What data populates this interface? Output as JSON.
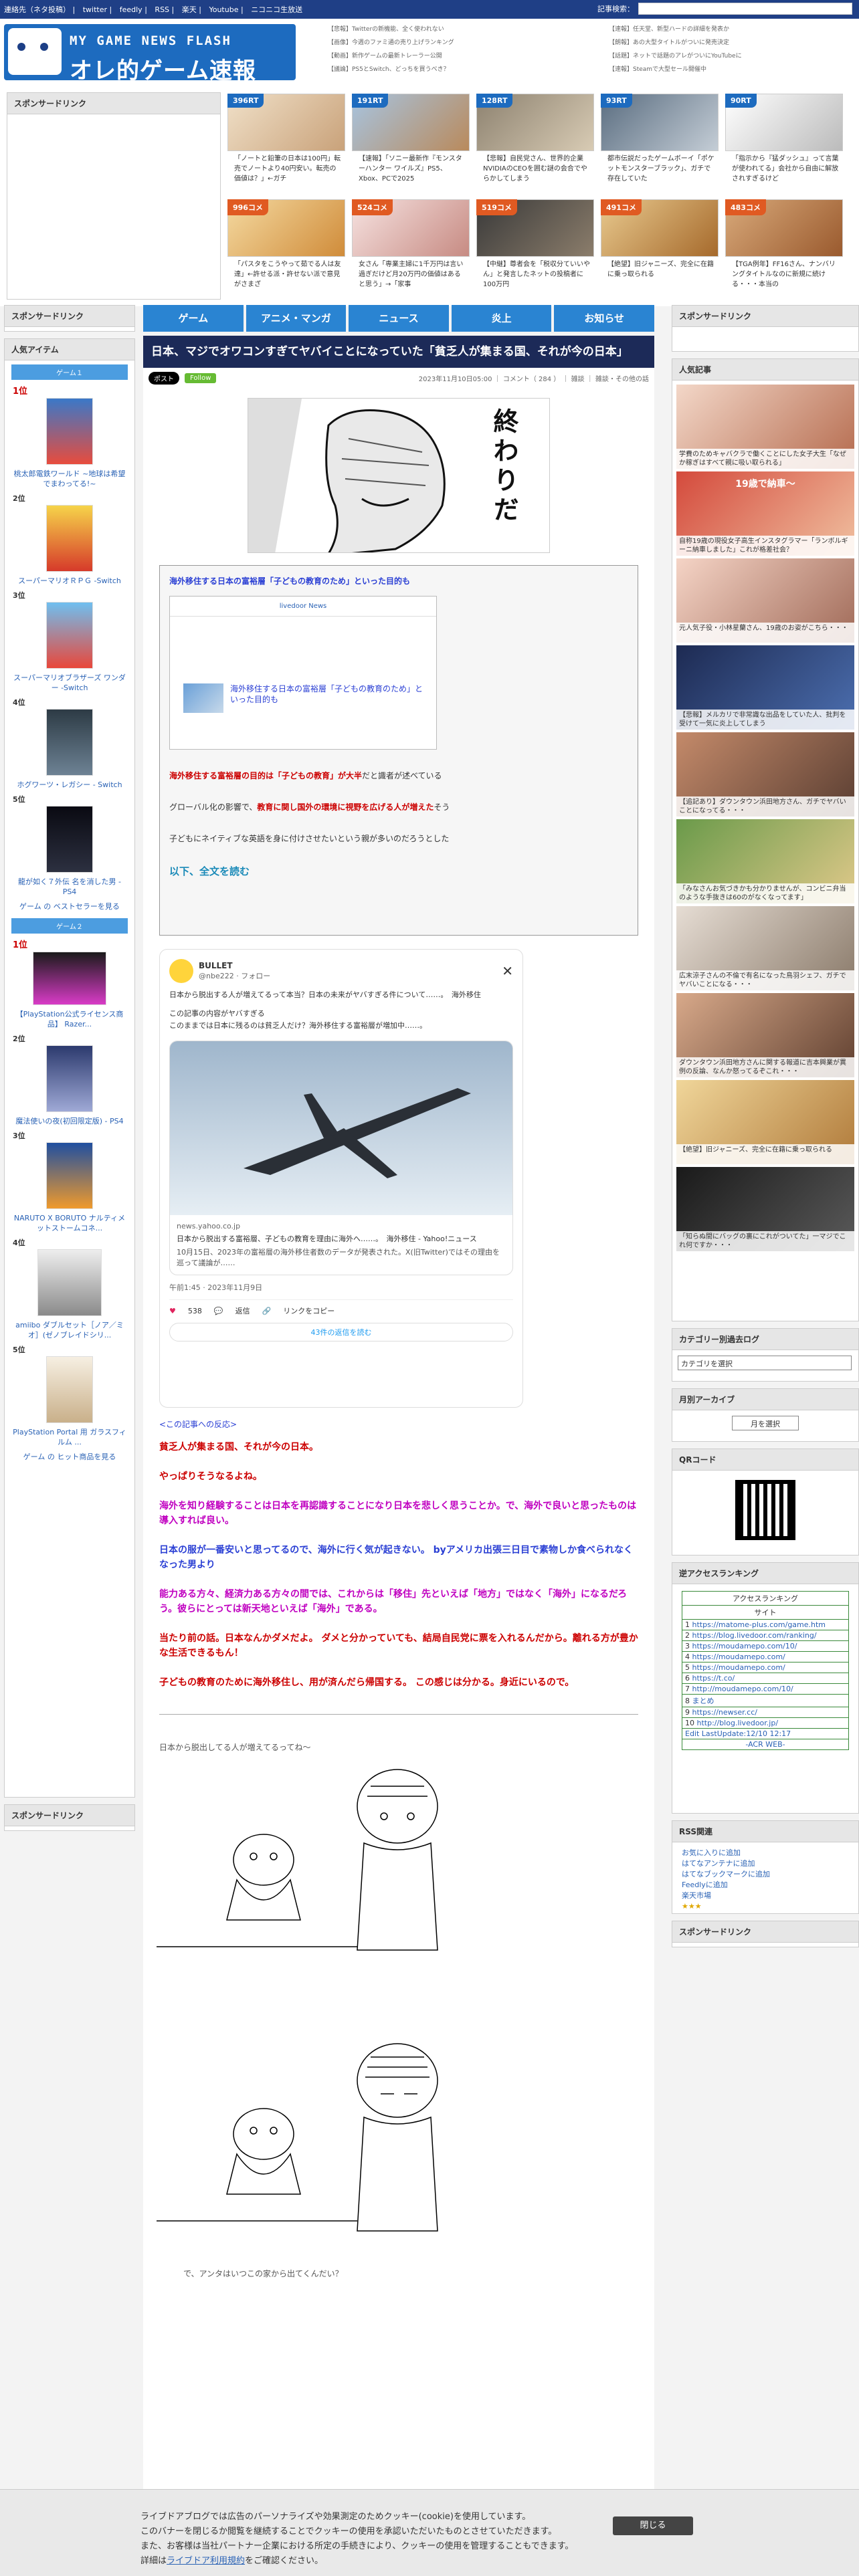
{
  "topbar": {
    "links": [
      "連絡先（ネタ投稿）",
      "twitter",
      "feedly",
      "RSS",
      "楽天",
      "Youtube",
      "ニコニコ生放送"
    ],
    "search_label": "記事検索："
  },
  "header": {
    "logo_line1": "MY GAME NEWS FLASH",
    "logo_line2": "オレ的ゲーム速報@JIN",
    "side_links": [
      "【悲報】Twitterの新機能、全く使われない",
      "【速報】任天堂、新型ハードの詳細を発表か",
      "【画像】今週のファミ通の売り上げランキング",
      "【朗報】あの大型タイトルがついに発売決定",
      "【動画】新作ゲームの最新トレーラー公開",
      "【話題】ネットで話題のアレがついにYouTubeに",
      "【議論】PS5とSwitch、どっちを買うべき？",
      "【速報】Steamで大型セール開催中"
    ]
  },
  "promo": {
    "sponsor_title": "スポンサードリンク",
    "tiles_row1": [
      {
        "badge": "396RT",
        "caption": "「ノートと鉛筆の日本は100円」転売でノートより40円安い。転売の価値は？」←ガチ"
      },
      {
        "badge": "191RT",
        "caption": "【速報】「ソニー最新作『モンスターハンター ワイルズ』PS5、Xbox、PCで2025"
      },
      {
        "badge": "128RT",
        "caption": "【悲報】自民党さん、世界的企業NVIDIAのCEOを囲む謎の会合でやらかしてしまう"
      },
      {
        "badge": "93RT",
        "caption": "都市伝説だったゲームボーイ「ポケットモンスターブラック」、ガチで存在していた"
      },
      {
        "badge": "90RT",
        "caption": "「指示から『猛ダッシュ』って言葉が使われてる」会社から自由に解放されすぎるけど"
      }
    ],
    "tiles_row2": [
      {
        "badge": "996コメ",
        "caption": "「パスタをこうやって茹でる人は友達」←許せる派・許せない派で意見がさまざ"
      },
      {
        "badge": "524コメ",
        "caption": "女さん「専業主婦に1千万円は言い過ぎだけど月20万円の価値はあると思う」→「家事"
      },
      {
        "badge": "519コメ",
        "caption": "【中継】尊者会を「税収分ていいやん」と発言したネットの投稿者に100万円"
      },
      {
        "badge": "491コメ",
        "caption": "【絶望】旧ジャニーズ、完全に在籍に乗っ取られる"
      },
      {
        "badge": "483コメ",
        "caption": "【TGA例年】FF16さん、ナンバリングタイトルなのに新規に続ける・・・本当の"
      }
    ]
  },
  "nav": [
    "ゲーム",
    "アニメ・マンガ",
    "ニュース",
    "炎上",
    "お知らせ"
  ],
  "left": {
    "sponsor_title": "スポンサードリンク",
    "items_title": "人気アイテム",
    "game1_label": "ゲーム１",
    "game2_label": "ゲーム２",
    "ranks1": [
      {
        "no": "1位",
        "name": "桃太郎電鉄ワールド ~地球は希望でまわってる!~"
      },
      {
        "no": "2位",
        "name": "スーパーマリオＲＰＧ -Switch"
      },
      {
        "no": "3位",
        "name": "スーパーマリオブラザーズ ワンダー -Switch"
      },
      {
        "no": "4位",
        "name": "ホグワーツ・レガシー - Switch"
      },
      {
        "no": "5位",
        "name": "龍が如く７外伝 名を消した男 - PS4"
      }
    ],
    "bestseller_link": "ゲーム の ベストセラーを見る",
    "ranks2": [
      {
        "no": "1位",
        "name": "【PlayStation公式ライセンス商品】 Razer..."
      },
      {
        "no": "2位",
        "name": "魔法使いの夜(初回限定版) - PS4"
      },
      {
        "no": "3位",
        "name": "NARUTO X BORUTO ナルティメットストームコネ..."
      },
      {
        "no": "4位",
        "name": "amiibo ダブルセット［ノア／ミオ］(ゼノブレイドシリ..."
      },
      {
        "no": "5位",
        "name": "PlayStation Portal 用 ガラスフィルム ..."
      }
    ],
    "hit_link": "ゲーム の ヒット商品を見る",
    "sponsor_bottom": "スポンサードリンク"
  },
  "article": {
    "title": "日本、マジでオワコンすぎてヤバイことになっていた「貧乏人が集まる国、それが今の日本」",
    "x_btn": "ポスト",
    "follow_btn": "Follow",
    "meta": "2023年11月10日05:00 ｜ コメント（ 284 ） ｜ 雑談 ｜ 雑談・その他の話",
    "manga_text": "終わりだ",
    "box_heading": "海外移住する日本の富裕層「子どもの教育のため」といった目的も",
    "box_card_site": "livedoor News",
    "box_card_title": "海外移住する日本の富裕層「子どもの教育のため」といった目的も",
    "box_p1_red": "海外移住する富裕層の目的は「子どもの教育」が大半",
    "box_p1_rest": "だと識者が述べている",
    "box_p2_pre": "グローバル化の影響で、",
    "box_p2_red": "教育に関し国外の環境に視野を広げる人が増えた",
    "box_p2_post": "そう",
    "box_p3": "子どもにネイティブな英語を身に付けさせたいという親が多いのだろうとした",
    "read_more": "以下、全文を読む",
    "tweet_name": "BULLET",
    "tweet_handle": "@nbe222 · フォロー",
    "tweet_text1": "日本から脱出する人が増えてるって本当？日本の未来がヤバすぎる件について……。　海外移住",
    "tweet_text2": "この記事の内容がヤバすぎる",
    "tweet_text3": "このままでは日本に残るのは貧乏人だけ？海外移住する富裕層が増加中……。",
    "tweet_card_domain": "news.yahoo.co.jp",
    "tweet_card_title": "日本から脱出する富裕層、子どもの教育を理由に海外へ……。　海外移住 - Yahoo!ニュース",
    "tweet_card_desc": "10月15日、2023年の富裕層の海外移住者数のデータが発表された。X(旧Twitter)ではその理由を巡って議論が……",
    "tweet_time": "午前1:45 · 2023年11月9日",
    "tweet_likes": "538",
    "tweet_reply": "返信",
    "tweet_copy": "リンクをコピー",
    "tweet_more": "43件の返信を読む",
    "reaction_head": "<この記事への反応>",
    "reactions": [
      {
        "cls": "redtxt",
        "text": "貧乏人が集まる国、それが今の日本。"
      },
      {
        "cls": "redtxt",
        "text": "やっぱりそうなるよね。"
      },
      {
        "cls": "mag",
        "text": "海外を知り経験することは日本を再認識することになり日本を悲しく思うことか。で、海外で良いと思ったものは導入すれば良い。"
      },
      {
        "cls": "blu",
        "text": "日本の服が一番安いと思ってるので、海外に行く気が起きない。 byアメリカ出張三日目で素物しか食べられなくなった男より"
      },
      {
        "cls": "mag",
        "text": "能力ある方々、経済力ある方々の間では、これからは「移住」先といえば「地方」ではなく「海外」になるだろう。彼らにとっては新天地といえば「海外」である。"
      },
      {
        "cls": "redtxt",
        "text": "当たり前の話。日本なんかダメだよ。 ダメと分かっていても、結局自民党に票を入れるんだから。離れる方が豊かな生活できるもん！"
      },
      {
        "cls": "redtxt",
        "text": "子どもの教育のために海外移住し、用が済んだら帰国する。 この感じは分かる。身近にいるので。"
      }
    ],
    "aa_caption1": "日本から脱出してる人が増えてるってね～",
    "aa_caption2": "で、アンタはいつこの家から出てくんだい？"
  },
  "right": {
    "sponsor_title": "スポンサードリンク",
    "popular_title": "人気記事",
    "popular": [
      "学費のためキャバクラで働くことにした女子大生「なぜか稼ぎはすべて親に吸い取られる」",
      "19歳で納車〜",
      "自称19歳の現役女子高生インスタグラマー「ランボルギーニ納車しました」これが格差社会？",
      "元人気子役・小林星蘭さん、19歳のお姿がこちら・・・",
      "【悲報】メルカリで非常識な出品をしていた人、批判を受けて一気に炎上してしまう",
      "【追記あり】ダウンタウン浜田地方さん、ガチでヤバいことになってる・・・",
      "「みなさんお気づきかも分かりませんが、コンビニ弁当のような手抜きは60のがなくなってます」",
      "広末涼子さんの不倫で有名になった鳥羽シェフ、ガチでヤバいことになる・・・",
      "ダウンタウン浜田地方さんに関する報道に吉本興業が異例の反論、なんか怒ってるぞこれ・・・",
      "【絶望】旧ジャニーズ、完全に在籍に乗っ取られる",
      "「知らぬ間にバッグの裏にこれがついてた」一マジでこれ何ですか・・・"
    ],
    "category_title": "カテゴリー別過去ログ",
    "category_select": "カテゴリを選択",
    "archive_title": "月別アーカイブ",
    "archive_select": "月を選択",
    "qr_title": "QRコード",
    "access_title": "逆アクセスランキング",
    "access_table_head": "アクセスランキング",
    "access_site_col": "サイト",
    "access_sites": [
      "https://matome-plus.com/game.htm",
      "https://blog.livedoor.com/ranking/",
      "https://moudamepo.com/10/",
      "https://moudamepo.com/",
      "https://moudamepo.com/",
      "https://t.co/",
      "http://moudamepo.com/10/",
      "まとめ",
      "https://newser.cc/",
      "http://blog.livedoor.jp/"
    ],
    "access_edit": "Edit LastUpdate:12/10 12:17",
    "access_footer": "-ACR WEB-",
    "rss_title": "RSS関連",
    "rss_links": [
      "お気に入りに追加",
      "はてなアンテナに追加",
      "はてなブックマークに追加",
      "Feedlyに追加",
      "楽天市場"
    ],
    "sponsor_bottom": "スポンサードリンク"
  },
  "cookie": {
    "line1": "ライブドアブログでは広告のパーソナライズや効果測定のためクッキー(cookie)を使用しています。",
    "line2": "このバナーを閉じるか閲覧を継続することでクッキーの使用を承認いただいたものとさせていただきます。",
    "line3": "また、お客様は当社パートナー企業における所定の手続きにより、クッキーの使用を管理することもできます。",
    "line4_pre": "詳細は",
    "line4_link": "ライブドア利用規約",
    "line4_post": "をご確認ください。",
    "close": "閉じる"
  },
  "colors": {
    "topbar": "#1f3f86",
    "nav": "#2a84d2",
    "title_bar": "#1c2a58",
    "rank_red": "#cc0000"
  }
}
